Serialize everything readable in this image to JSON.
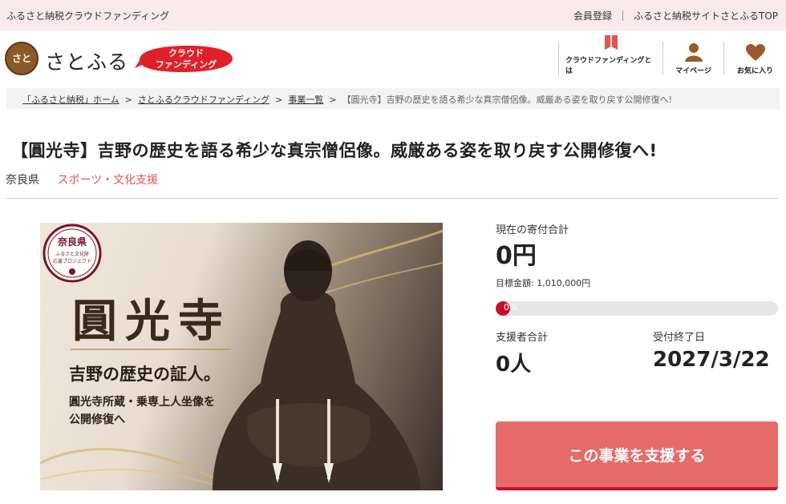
{
  "topbar": {
    "tagline": "ふるさと納税クラウドファンディング",
    "links": [
      "会員登録",
      "ふるさと納税サイトさとふるTOP"
    ]
  },
  "header": {
    "logo_seal": "さと",
    "logo_text": "さとふる",
    "badge_line1": "クラウド",
    "badge_line2": "ファンディング",
    "nav": [
      {
        "label": "クラウドファンディングとは",
        "icon": "book-icon"
      },
      {
        "label": "マイページ",
        "icon": "user-icon"
      },
      {
        "label": "お気に入り",
        "icon": "heart-icon"
      }
    ]
  },
  "breadcrumb": {
    "items": [
      "「ふるさと納税」ホーム",
      "さとふるクラウドファンディング",
      "事業一覧"
    ],
    "separator": ">",
    "current": "【圓光寺】吉野の歴史を語る希少な真宗僧侶像。威厳ある姿を取り戻す公開修復へ!"
  },
  "project": {
    "title": "【圓光寺】吉野の歴史を語る希少な真宗僧侶像。威厳ある姿を取り戻す公開修復へ!",
    "prefecture": "奈良県",
    "category": "スポーツ・文化支援",
    "image": {
      "seal_title": "奈良県",
      "seal_sub1": "ふるさと文化財",
      "seal_sub2": "応援プロジェクト",
      "headline": "圓光寺",
      "subhead": "吉野の歴史の証人。",
      "caption1": "圓光寺所蔵・乗専上人坐像を",
      "caption2": "公開修復へ"
    }
  },
  "stats": {
    "total_label": "現在の寄付合計",
    "total_value": "0円",
    "target_text": "目標金額: 1,010,000円",
    "progress_text": "0%",
    "progress_fraction": 0.0,
    "supporters_label": "支援者合計",
    "supporters_value": "0人",
    "deadline_label": "受付終了日",
    "deadline_value": "2027/3/22"
  },
  "cta": {
    "label": "この事業を支援する"
  },
  "colors": {
    "accent": "#e76a6a",
    "accent_dark": "#c8102e",
    "topbar_bg": "#fbeaea",
    "category": "#e05555"
  }
}
